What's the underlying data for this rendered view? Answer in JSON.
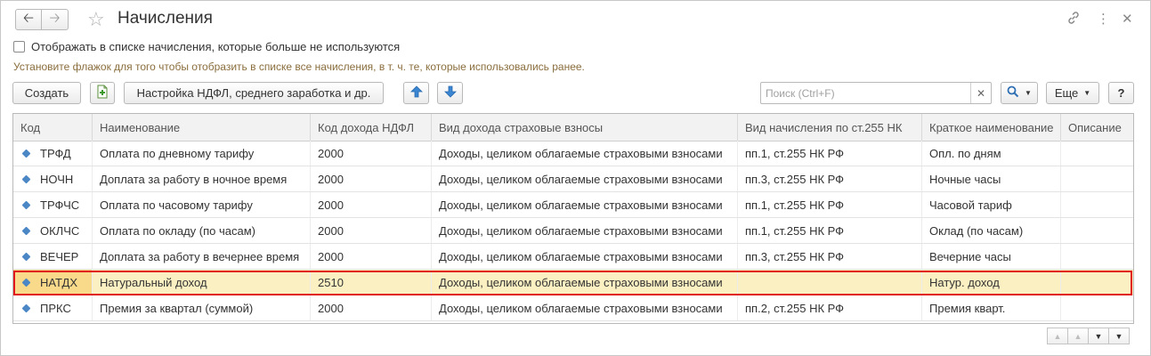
{
  "window": {
    "title": "Начисления"
  },
  "options": {
    "show_unused_label": "Отображать в списке начисления, которые больше не используются",
    "hint": "Установите флажок для того чтобы отобразить в списке все начисления, в т. ч. те, которые использовались ранее."
  },
  "toolbar": {
    "create_label": "Создать",
    "settings_label": "Настройка НДФЛ, среднего заработка и др.",
    "more_label": "Еще",
    "help_label": "?",
    "search_placeholder": "Поиск (Ctrl+F)",
    "search_value": ""
  },
  "icons": {
    "back": "arrow-left-icon",
    "forward": "arrow-right-icon",
    "favorite": "star-icon",
    "link": "link-icon",
    "menu": "kebab-menu-icon",
    "close": "close-icon",
    "add_copy": "add-document-icon",
    "move_up": "arrow-up-icon",
    "move_down": "arrow-down-icon",
    "search": "search-icon"
  },
  "colors": {
    "row_marker": "#4b86c5",
    "selected_row": "#fbf0c2",
    "highlight_outline": "#e0171d",
    "hint_text": "#8a6e3e"
  },
  "table": {
    "columns": [
      "Код",
      "Наименование",
      "Код дохода НДФЛ",
      "Вид дохода страховые взносы",
      "Вид начисления по ст.255 НК",
      "Краткое наименование",
      "Описание"
    ],
    "rows": [
      [
        "ТРФД",
        "Оплата по дневному тарифу",
        "2000",
        "Доходы, целиком облагаемые страховыми взносами",
        "пп.1, ст.255 НК РФ",
        "Опл. по дням",
        ""
      ],
      [
        "НОЧН",
        "Доплата за работу в ночное время",
        "2000",
        "Доходы, целиком облагаемые страховыми взносами",
        "пп.3, ст.255 НК РФ",
        "Ночные часы",
        ""
      ],
      [
        "ТРФЧС",
        "Оплата по часовому тарифу",
        "2000",
        "Доходы, целиком облагаемые страховыми взносами",
        "пп.1, ст.255 НК РФ",
        "Часовой тариф",
        ""
      ],
      [
        "ОКЛЧС",
        "Оплата по окладу (по часам)",
        "2000",
        "Доходы, целиком облагаемые страховыми взносами",
        "пп.1, ст.255 НК РФ",
        "Оклад (по часам)",
        ""
      ],
      [
        "ВЕЧЕР",
        "Доплата за работу в вечернее время",
        "2000",
        "Доходы, целиком облагаемые страховыми взносами",
        "пп.3, ст.255 НК РФ",
        "Вечерние часы",
        ""
      ],
      [
        "НАТДХ",
        "Натуральный доход",
        "2510",
        "Доходы, целиком облагаемые страховыми взносами",
        "",
        "Натур. доход",
        ""
      ],
      [
        "ПРКС",
        "Премия за квартал (суммой)",
        "2000",
        "Доходы, целиком облагаемые страховыми взносами",
        "пп.2, ст.255 НК РФ",
        "Премия кварт.",
        ""
      ]
    ],
    "selected_row_index": 5
  }
}
